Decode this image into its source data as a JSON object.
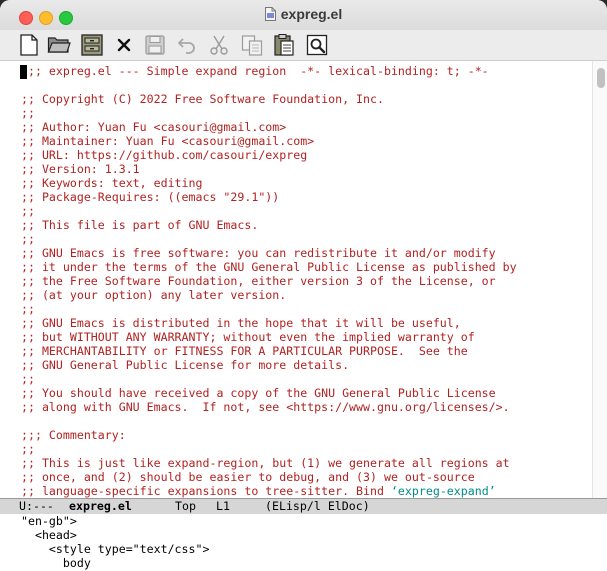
{
  "window": {
    "title": "expreg.el"
  },
  "toolbar": {
    "buttons": [
      {
        "name": "new-file",
        "icon": "new-file-icon"
      },
      {
        "name": "open-folder",
        "icon": "folder-icon"
      },
      {
        "name": "dired",
        "icon": "cabinet-icon"
      },
      {
        "name": "close-buffer",
        "icon": "close-x-icon"
      },
      {
        "name": "save",
        "icon": "save-icon"
      },
      {
        "name": "undo",
        "icon": "undo-icon"
      },
      {
        "name": "cut",
        "icon": "cut-icon"
      },
      {
        "name": "copy",
        "icon": "copy-icon"
      },
      {
        "name": "paste",
        "icon": "paste-icon"
      },
      {
        "name": "search",
        "icon": "search-icon"
      }
    ]
  },
  "editor": {
    "lines": [
      ";;; expreg.el --- Simple expand region  -*- lexical-binding: t; -*-",
      "",
      ";; Copyright (C) 2022 Free Software Foundation, Inc.",
      ";;",
      ";; Author: Yuan Fu <casouri@gmail.com>",
      ";; Maintainer: Yuan Fu <casouri@gmail.com>",
      ";; URL: https://github.com/casouri/expreg",
      ";; Version: 1.3.1",
      ";; Keywords: text, editing",
      ";; Package-Requires: ((emacs \"29.1\"))",
      ";;",
      ";; This file is part of GNU Emacs.",
      ";;",
      ";; GNU Emacs is free software: you can redistribute it and/or modify",
      ";; it under the terms of the GNU General Public License as published by",
      ";; the Free Software Foundation, either version 3 of the License, or",
      ";; (at your option) any later version.",
      ";;",
      ";; GNU Emacs is distributed in the hope that it will be useful,",
      ";; but WITHOUT ANY WARRANTY; without even the implied warranty of",
      ";; MERCHANTABILITY or FITNESS FOR A PARTICULAR PURPOSE.  See the",
      ";; GNU General Public License for more details.",
      ";;",
      ";; You should have received a copy of the GNU General Public License",
      ";; along with GNU Emacs.  If not, see <https://www.gnu.org/licenses/>.",
      "",
      ";;; Commentary:",
      ";;",
      ";; This is just like expand-region, but (1) we generate all regions at",
      ";; once, and (2) should be easier to debug, and (3) we out-source",
      ";; language-specific expansions to tree-sitter. Bind ‘expreg-expand’"
    ]
  },
  "modeline": {
    "status": "U:---",
    "buffer": "expreg.el",
    "position": "Top",
    "line": "L1",
    "mode": "(ELisp/l ElDoc)"
  },
  "lower_buffer": {
    "lines": [
      "\"en-gb\">",
      "  <head>",
      "    <style type=\"text/css\">",
      "      body"
    ]
  },
  "colors": {
    "comment": "#b22222",
    "modeline_bg": "#d6d6d6",
    "link_teal": "#008b8b"
  }
}
